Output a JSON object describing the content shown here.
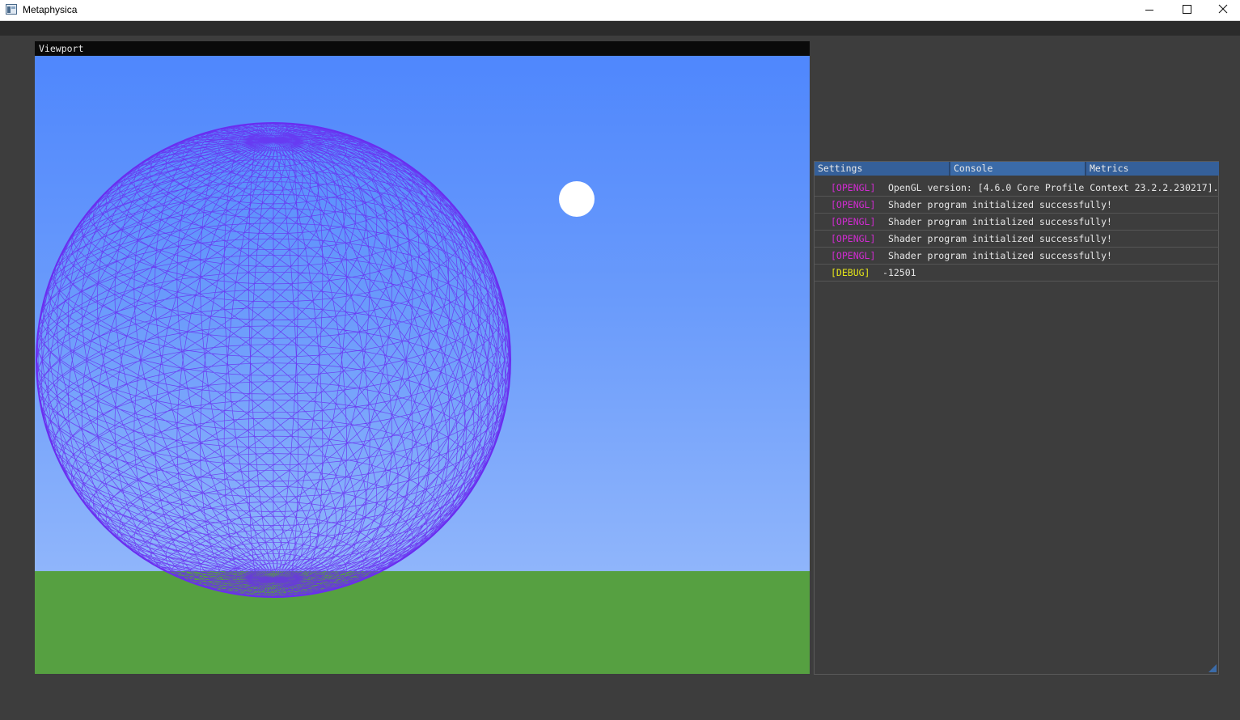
{
  "window": {
    "title": "Metaphysica",
    "icon": "app-window-icon",
    "controls": [
      "minimize-icon",
      "maximize-icon",
      "close-icon"
    ]
  },
  "viewport": {
    "title": "Viewport",
    "colors": {
      "sky_top": "#4f87fd",
      "sky_bottom": "#8fb5fb",
      "ground": "#56a041",
      "sphere_wireframe": "#6a2df0",
      "light": "#ffffff"
    }
  },
  "panel": {
    "tabs": [
      {
        "label": "Settings",
        "active": false
      },
      {
        "label": "Console",
        "active": true
      },
      {
        "label": "Metrics",
        "active": false
      }
    ],
    "console": [
      {
        "tag": "[OPENGL]",
        "color": "#d22bd2",
        "message": "OpenGL version: [4.6.0 Core Profile Context 23.2.2.230217]."
      },
      {
        "tag": "[OPENGL]",
        "color": "#d22bd2",
        "message": "Shader program initialized successfully!"
      },
      {
        "tag": "[OPENGL]",
        "color": "#d22bd2",
        "message": "Shader program initialized successfully!"
      },
      {
        "tag": "[OPENGL]",
        "color": "#d22bd2",
        "message": "Shader program initialized successfully!"
      },
      {
        "tag": "[OPENGL]",
        "color": "#d22bd2",
        "message": "Shader program initialized successfully!"
      },
      {
        "tag": "[DEBUG]",
        "color": "#e5e51a",
        "message": "-12501"
      }
    ]
  }
}
